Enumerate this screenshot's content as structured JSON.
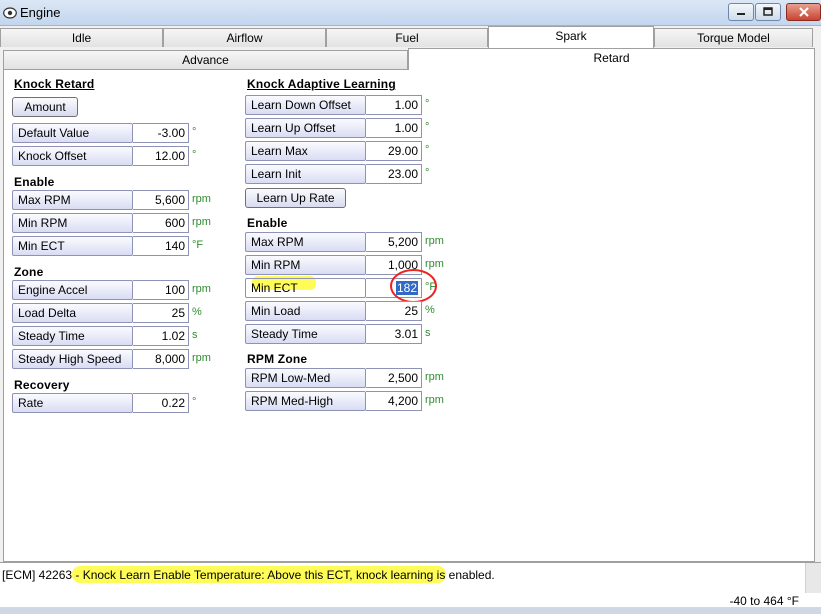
{
  "window": {
    "title": "Engine"
  },
  "tabs": {
    "primary": [
      "Idle",
      "Airflow",
      "Fuel",
      "Spark",
      "Torque Model"
    ],
    "primary_active": "Spark",
    "secondary": [
      "Advance",
      "Retard"
    ],
    "secondary_active": "Retard"
  },
  "left": {
    "knock_retard": {
      "heading": "Knock Retard",
      "amount_button": "Amount",
      "default_value": {
        "label": "Default Value",
        "value": "-3.00",
        "unit": "°"
      },
      "knock_offset": {
        "label": "Knock Offset",
        "value": "12.00",
        "unit": "°"
      }
    },
    "enable": {
      "heading": "Enable",
      "max_rpm": {
        "label": "Max RPM",
        "value": "5,600",
        "unit": "rpm"
      },
      "min_rpm": {
        "label": "Min RPM",
        "value": "600",
        "unit": "rpm"
      },
      "min_ect": {
        "label": "Min ECT",
        "value": "140",
        "unit": "°F"
      }
    },
    "zone": {
      "heading": "Zone",
      "engine_accel": {
        "label": "Engine Accel",
        "value": "100",
        "unit": "rpm"
      },
      "load_delta": {
        "label": "Load Delta",
        "value": "25",
        "unit": "%"
      },
      "steady_time": {
        "label": "Steady Time",
        "value": "1.02",
        "unit": "s"
      },
      "steady_high_speed": {
        "label": "Steady High Speed",
        "value": "8,000",
        "unit": "rpm"
      }
    },
    "recovery": {
      "heading": "Recovery",
      "rate": {
        "label": "Rate",
        "value": "0.22",
        "unit": "°"
      }
    }
  },
  "right": {
    "knock_adaptive": {
      "heading": "Knock Adaptive Learning",
      "learn_down_offset": {
        "label": "Learn Down Offset",
        "value": "1.00",
        "unit": "°"
      },
      "learn_up_offset": {
        "label": "Learn Up Offset",
        "value": "1.00",
        "unit": "°"
      },
      "learn_max": {
        "label": "Learn Max",
        "value": "29.00",
        "unit": "°"
      },
      "learn_init": {
        "label": "Learn Init",
        "value": "23.00",
        "unit": "°"
      },
      "learn_up_rate_button": "Learn Up Rate"
    },
    "enable": {
      "heading": "Enable",
      "max_rpm": {
        "label": "Max RPM",
        "value": "5,200",
        "unit": "rpm"
      },
      "min_rpm": {
        "label": "Min RPM",
        "value": "1,000",
        "unit": "rpm"
      },
      "min_ect": {
        "label": "Min ECT",
        "value": "182",
        "unit": "°F"
      },
      "min_load": {
        "label": "Min Load",
        "value": "25",
        "unit": "%"
      },
      "steady_time": {
        "label": "Steady Time",
        "value": "3.01",
        "unit": "s"
      }
    },
    "rpm_zone": {
      "heading": "RPM Zone",
      "low_med": {
        "label": "RPM Low-Med",
        "value": "2,500",
        "unit": "rpm"
      },
      "med_high": {
        "label": "RPM Med-High",
        "value": "4,200",
        "unit": "rpm"
      }
    }
  },
  "status": {
    "prefix": "[ECM] 42263 - ",
    "message": "Knock Learn Enable Temperature: Above this ECT, knock learning is enabled.",
    "range": "-40 to 464 °F"
  },
  "colors": {
    "highlight": "#fffb3a",
    "circle": "#e22222",
    "unit": "#2e8b2e",
    "selection": "#3169c6"
  }
}
